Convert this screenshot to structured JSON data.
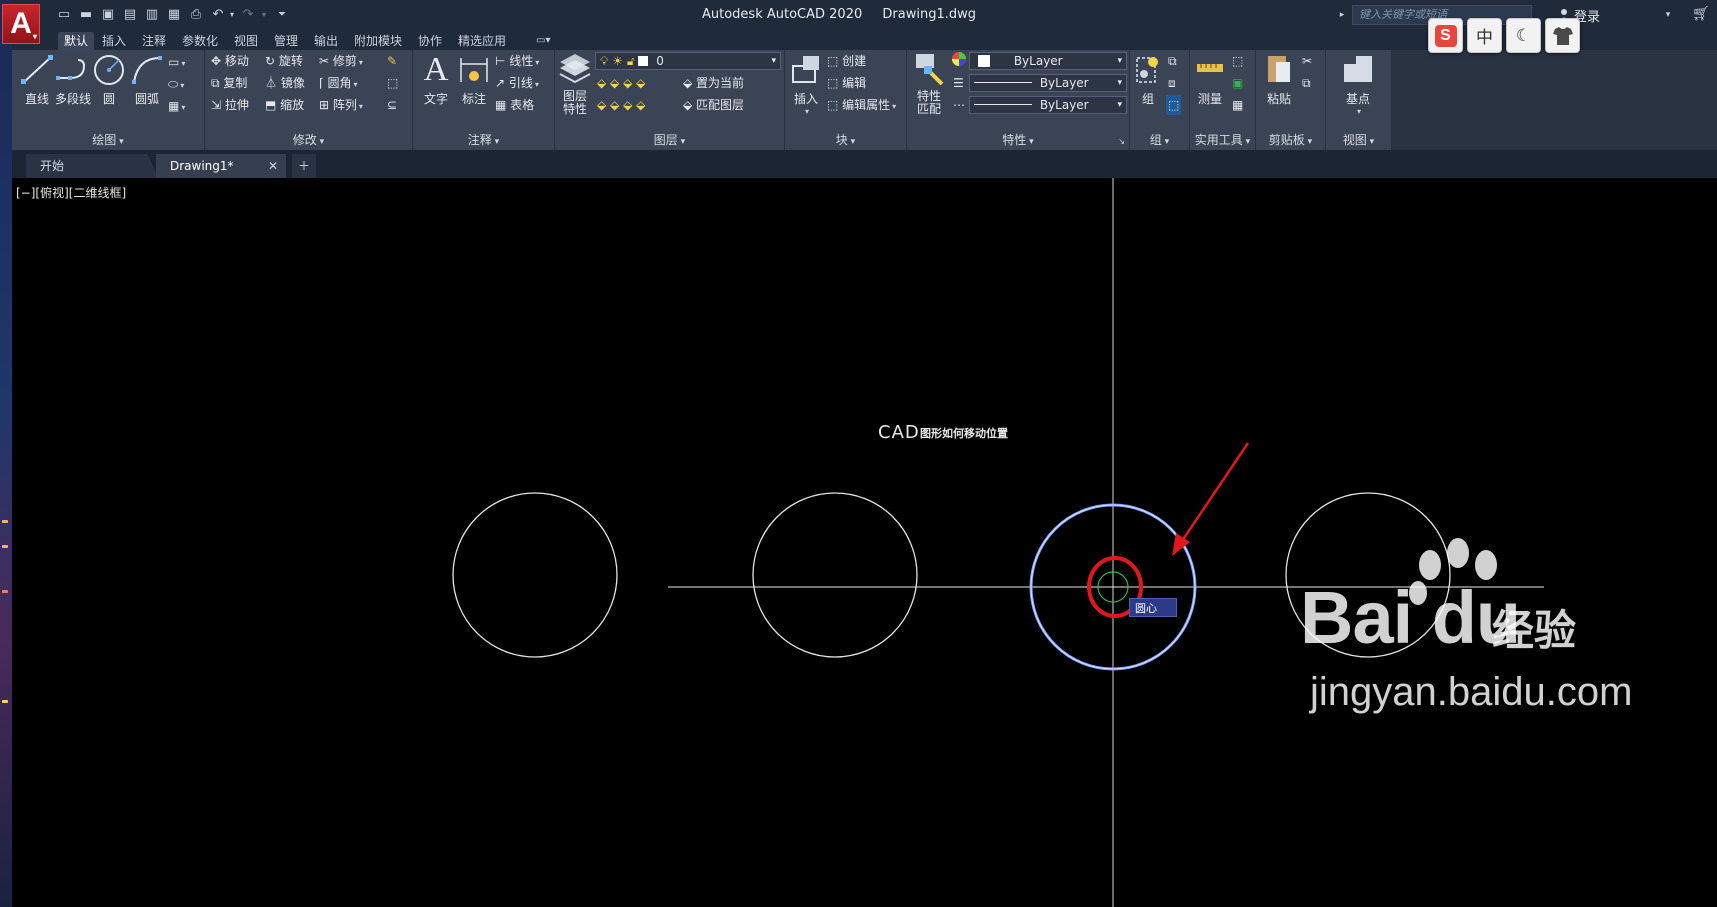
{
  "app": {
    "title": "Autodesk AutoCAD 2020",
    "document": "Drawing1.dwg",
    "logo_letter": "A",
    "search_placeholder": "键入关键字或短语",
    "signin_label": "登录"
  },
  "ime_toolbar": {
    "items": [
      {
        "label": "S",
        "icon": "sogou-logo-icon"
      },
      {
        "label": "中",
        "icon": "chinese-mode-icon"
      },
      {
        "label": "☾",
        "icon": "moon-icon"
      },
      {
        "label": "👕",
        "icon": "skin-icon"
      }
    ]
  },
  "ribbon_tabs": [
    {
      "label": "默认",
      "active": true
    },
    {
      "label": "插入"
    },
    {
      "label": "注释"
    },
    {
      "label": "参数化"
    },
    {
      "label": "视图"
    },
    {
      "label": "管理"
    },
    {
      "label": "输出"
    },
    {
      "label": "附加模块"
    },
    {
      "label": "协作"
    },
    {
      "label": "精选应用"
    }
  ],
  "panels": {
    "draw": {
      "title": "绘图",
      "line": "直线",
      "polyline": "多段线",
      "circle": "圆",
      "arc": "圆弧"
    },
    "modify": {
      "title": "修改",
      "move": "移动",
      "rotate": "旋转",
      "trim": "修剪",
      "copy": "复制",
      "mirror": "镜像",
      "fillet": "圆角",
      "stretch": "拉伸",
      "scale": "缩放",
      "array": "阵列"
    },
    "annotation": {
      "title": "注释",
      "text": "文字",
      "dimension": "标注",
      "linear": "线性",
      "leader": "引线",
      "table": "表格"
    },
    "layers": {
      "title": "图层",
      "properties": "图层\n特性",
      "properties_line1": "图层",
      "properties_line2": "特性",
      "current_layer": "0",
      "set_current": "置为当前",
      "match_layer": "匹配图层"
    },
    "block": {
      "title": "块",
      "insert": "插入",
      "create": "创建",
      "edit": "编辑",
      "edit_attributes": "编辑属性"
    },
    "properties": {
      "title": "特性",
      "match_line1": "特性",
      "match_line2": "匹配",
      "color": "ByLayer",
      "linetype": "ByLayer",
      "lineweight": "ByLayer"
    },
    "groups": {
      "title": "组",
      "group": "组"
    },
    "utilities": {
      "title": "实用工具",
      "measure": "测量"
    },
    "clipboard": {
      "title": "剪贴板",
      "paste": "粘贴"
    },
    "view": {
      "title": "视图",
      "base": "基点"
    }
  },
  "doc_tabs": [
    {
      "label": "开始"
    },
    {
      "label": "Drawing1*",
      "active": true
    }
  ],
  "viewport": {
    "label": "[−][俯视][二维线框]",
    "drawing_title": "CAD图形如何移动位置",
    "drawing_title_latin": "CAD",
    "drawing_title_cjk": "图形如何移动位置",
    "snap_tooltip": "圆心"
  },
  "watermark": {
    "brand": "Bai du",
    "brand_cn": "经验",
    "url": "jingyan.baidu.com"
  },
  "colors": {
    "titlebar": "#1f2a3b",
    "ribbon": "#3b4455",
    "canvas": "#000000",
    "accent_red": "#e0181b",
    "highlight_blue": "#7a9cff",
    "snap_green": "#2fb84a"
  }
}
